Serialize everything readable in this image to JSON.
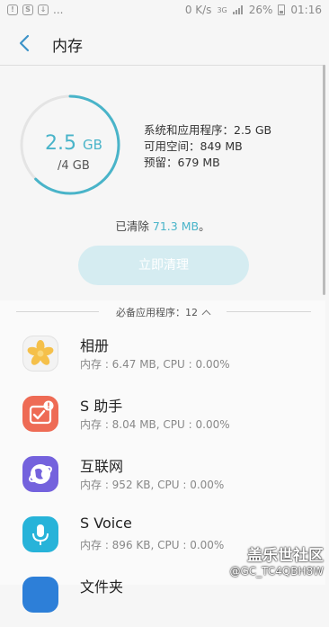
{
  "status_bar": {
    "dots": "...",
    "network_speed": "0 K/s",
    "network_type": "3G",
    "battery": "26%",
    "time": "01:16"
  },
  "header": {
    "title": "内存"
  },
  "storage": {
    "used_value": "2.5",
    "used_unit": "GB",
    "total": "/4 GB",
    "used_fraction": 0.625,
    "stat_system": "系统和应用程序：2.5 GB",
    "stat_free": "可用空间：849 MB",
    "stat_reserved": "预留：679 MB",
    "cleared_prefix": "已清除 ",
    "cleared_amount": "71.3 MB",
    "cleared_suffix": "。",
    "clean_button": "立即清理",
    "accent_color": "#49b4c9"
  },
  "section": {
    "label": "必备应用程序：12"
  },
  "apps": [
    {
      "name": "相册",
      "info": "内存 : 6.47 MB, CPU : 0.00%",
      "icon": "gallery-flower-icon",
      "color": "#f3f3f3"
    },
    {
      "name": "S 助手",
      "info": "内存 : 8.04 MB, CPU : 0.00%",
      "icon": "s-assistant-icon",
      "color": "#ee6b55"
    },
    {
      "name": "互联网",
      "info": "内存 : 952 KB, CPU : 0.00%",
      "icon": "internet-globe-icon",
      "color": "#7462dd"
    },
    {
      "name": "S Voice",
      "info": "内存 : 896 KB, CPU : 0.00%",
      "icon": "microphone-icon",
      "color": "#27b3d9"
    },
    {
      "name": "文件夹",
      "info": "",
      "icon": "folder-icon",
      "color": "#2d7fd8"
    }
  ],
  "watermark": {
    "line1": "盖乐世社区",
    "line2": "@GC_TC4QBH8W"
  }
}
